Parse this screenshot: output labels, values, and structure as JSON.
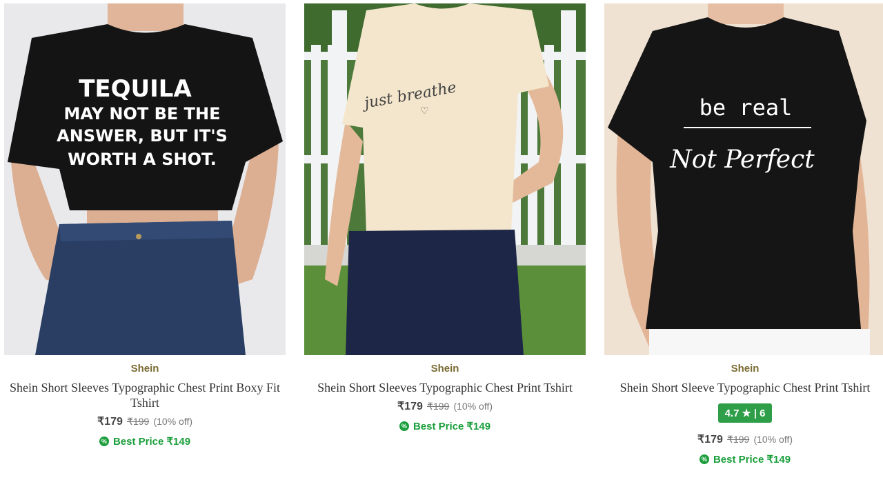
{
  "products": [
    {
      "brand": "Shein",
      "title": "Shein Short Sleeves Typographic Chest Print Boxy Fit Tshirt",
      "price": "₹179",
      "mrp": "₹199",
      "discount": "(10% off)",
      "best_price": "Best Price ₹149",
      "shirt_text": [
        "TEQUILA",
        "MAY NOT BE THE",
        "ANSWER, BUT IT'S",
        "WORTH A SHOT."
      ]
    },
    {
      "brand": "Shein",
      "title": "Shein Short Sleeves Typographic Chest Print Tshirt",
      "price": "₹179",
      "mrp": "₹199",
      "discount": "(10% off)",
      "best_price": "Best Price ₹149",
      "shirt_text": [
        "just breathe"
      ]
    },
    {
      "brand": "Shein",
      "title": "Shein Short Sleeve Typographic Chest Print Tshirt",
      "rating": "4.7",
      "rating_count": "6",
      "price": "₹179",
      "mrp": "₹199",
      "discount": "(10% off)",
      "best_price": "Best Price ₹149",
      "shirt_text": [
        "be real",
        "Not Perfect"
      ]
    }
  ],
  "icons": {
    "best_price": "percent-badge-icon",
    "rating": "star-icon"
  },
  "colors": {
    "brand": "#7a6a32",
    "best_price": "#1a9e3b",
    "rating_bg": "#2e9e48"
  }
}
